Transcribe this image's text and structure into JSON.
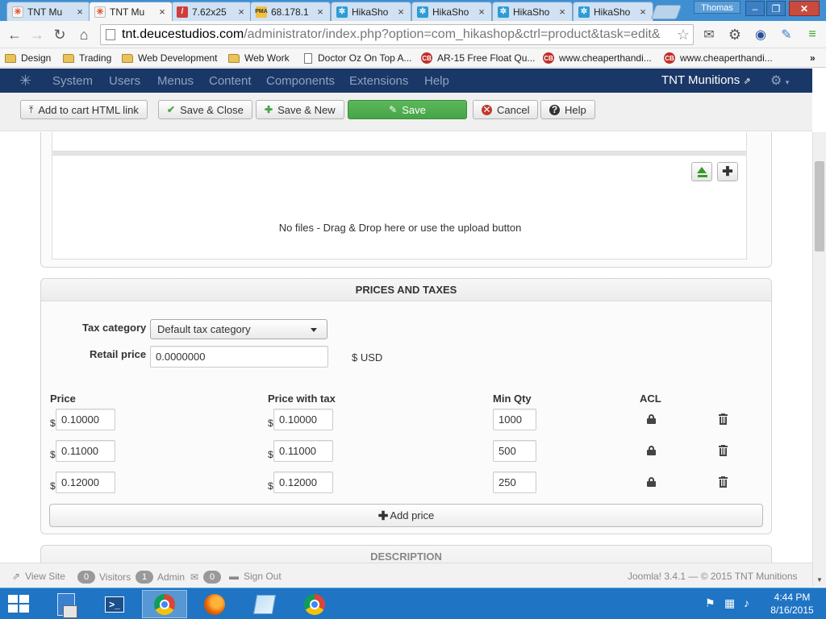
{
  "browser": {
    "tabs": [
      {
        "title": "TNT Mu",
        "favicon": "joomla-icon",
        "active": false
      },
      {
        "title": "TNT Mu",
        "favicon": "joomla-icon",
        "active": true
      },
      {
        "title": "7.62x25",
        "favicon": "bullet-icon",
        "active": false
      },
      {
        "title": "68.178.1",
        "favicon": "phpmyadmin-icon",
        "active": false
      },
      {
        "title": "HikaSho",
        "favicon": "hikashop-icon",
        "active": false
      },
      {
        "title": "HikaSho",
        "favicon": "hikashop-icon",
        "active": false
      },
      {
        "title": "HikaSho",
        "favicon": "hikashop-icon",
        "active": false
      },
      {
        "title": "HikaSho",
        "favicon": "hikashop-icon",
        "active": false
      }
    ],
    "user": "Thomas",
    "url_host": "tnt.deucestudios.com",
    "url_path": "/administrator/index.php?option=com_hikashop&ctrl=product&task=edit&",
    "bookmarks": [
      {
        "label": "Design",
        "type": "folder"
      },
      {
        "label": "Trading",
        "type": "folder"
      },
      {
        "label": "Web Development",
        "type": "folder"
      },
      {
        "label": "Web Work",
        "type": "folder"
      },
      {
        "label": "Doctor Oz On Top A...",
        "type": "page"
      },
      {
        "label": "AR-15 Free Float Qu...",
        "type": "cb"
      },
      {
        "label": "www.cheaperthandi...",
        "type": "cb"
      },
      {
        "label": "www.cheaperthandi...",
        "type": "cb"
      }
    ],
    "more": "»"
  },
  "admin_nav": {
    "menu": [
      "System",
      "Users",
      "Menus",
      "Content",
      "Components",
      "Extensions",
      "Help"
    ],
    "site_name": "TNT Munitions"
  },
  "toolbar": {
    "add_to_cart": "Add to cart HTML link",
    "save_close": "Save & Close",
    "save_new": "Save & New",
    "save": "Save",
    "cancel": "Cancel",
    "help": "Help"
  },
  "upload": {
    "drop_text": "No files - Drag & Drop here or use the upload button"
  },
  "prices": {
    "heading": "PRICES AND TAXES",
    "tax_category_label": "Tax category",
    "tax_category_value": "Default tax category",
    "retail_price_label": "Retail price",
    "retail_price_value": "0.0000000",
    "retail_currency": "$ USD",
    "columns": {
      "price": "Price",
      "price_with_tax": "Price with tax",
      "min_qty": "Min Qty",
      "acl": "ACL"
    },
    "currency_symbol": "$",
    "rows": [
      {
        "price": "0.10000",
        "price_with_tax": "0.10000",
        "min_qty": "1000"
      },
      {
        "price": "0.11000",
        "price_with_tax": "0.11000",
        "min_qty": "500"
      },
      {
        "price": "0.12000",
        "price_with_tax": "0.12000",
        "min_qty": "250"
      }
    ],
    "add_price": "Add price"
  },
  "description": {
    "heading": "DESCRIPTION"
  },
  "status_bar": {
    "view_site": "View Site",
    "visitors_count": "0",
    "visitors_label": "Visitors",
    "admin_count": "1",
    "admin_label": "Admin",
    "messages_count": "0",
    "sign_out": "Sign Out",
    "copyright": "Joomla! 3.4.1  —  © 2015 TNT Munitions"
  },
  "taskbar": {
    "time": "4:44 PM",
    "date": "8/16/2015"
  },
  "colors": {
    "admin_nav_bg": "#1a3867",
    "save_green": "#46a546",
    "cancel_red": "#c0392b",
    "taskbar_blue": "#1f74c4"
  }
}
